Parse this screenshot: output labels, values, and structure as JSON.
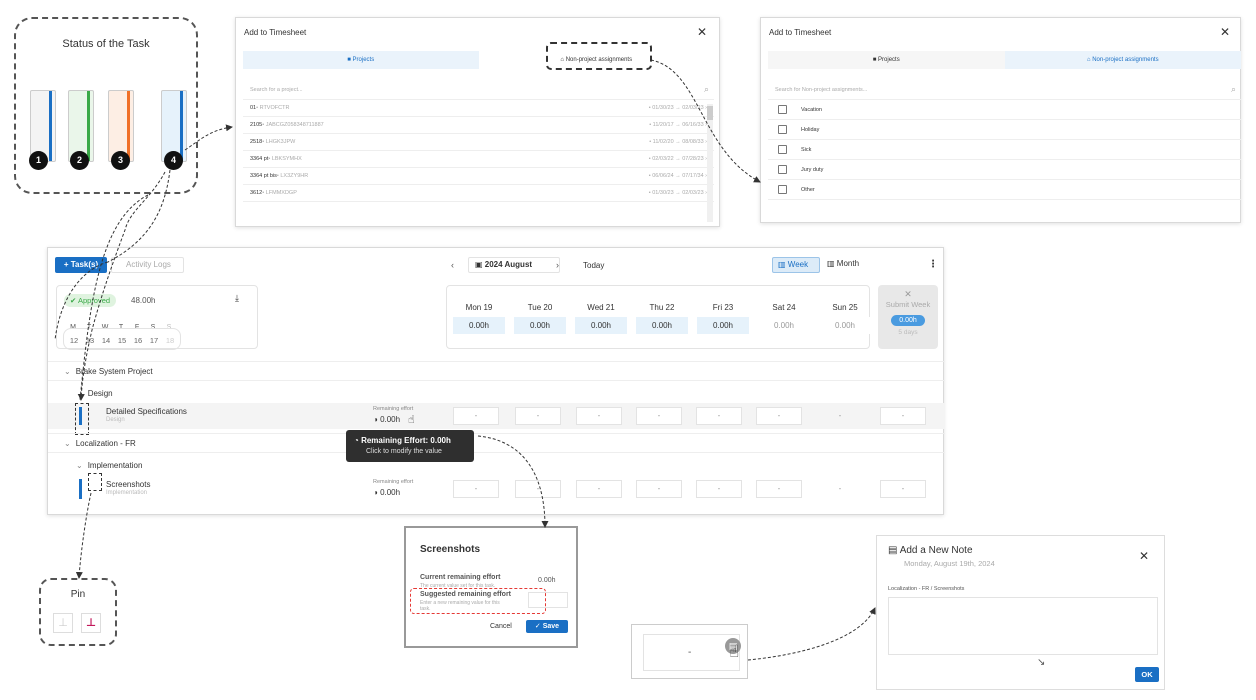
{
  "status_box": {
    "title": "Status of the Task",
    "numbers": [
      "1",
      "2",
      "3",
      "4"
    ],
    "bar_colors": [
      "#1a6fc4",
      "#3aa948",
      "#f07028",
      "#1a6fc4"
    ],
    "bar_bg": [
      "#f4f4f4",
      "#eaf6ea",
      "#fdeee4",
      "#e6f2fb"
    ]
  },
  "pin_box": {
    "title": "Pin"
  },
  "timesheet_projects": {
    "title": "Add to Timesheet",
    "tab_projects": "Projects",
    "tab_nonproject": "Non-project assignments",
    "search_placeholder": "Search for a project...",
    "rows": [
      {
        "name": "01",
        "code": " • RTVOFCTR",
        "dates": "• 01/30/23 → 02/03/23  ›"
      },
      {
        "name": "2105",
        "code": " • JABCGZ0583487118​87",
        "dates": "• 11/20/17 → 06/16/33  ›"
      },
      {
        "name": "2518",
        "code": " • LHGK3JPW",
        "dates": "• 11/02/20 → 08/08/33  ›"
      },
      {
        "name": "3364 pt",
        "code": " • LBKSYMHX",
        "dates": "• 02/03/22 → 07/28/23  ›"
      },
      {
        "name": "3364 pt bis",
        "code": " • LX3ZY9HR",
        "dates": "• 06/06/24 → 07/17/34  ›"
      },
      {
        "name": "3612",
        "code": " • LFMMXDGP",
        "dates": "• 01/30/23 → 02/03/23  ›"
      }
    ]
  },
  "timesheet_nonproject": {
    "title": "Add to Timesheet",
    "tab_projects": "Projects",
    "tab_nonproject": "Non-project assignments",
    "search_placeholder": "Search for Non-project assignments...",
    "items": [
      "Vacation",
      "Holiday",
      "Sick",
      "Jury duty",
      "Other"
    ]
  },
  "main": {
    "add_task": "+ Task(s)",
    "activity_logs": "Activity Logs",
    "month_label": "2024 August",
    "today": "Today",
    "week": "Week",
    "month": "Month",
    "approved": "Approved",
    "hours": "48.00h",
    "weekday_letters": [
      "M",
      "T",
      "W",
      "T",
      "F",
      "S",
      "S"
    ],
    "weekday_numbers": [
      "12",
      "13",
      "14",
      "15",
      "16",
      "17",
      "18"
    ],
    "days": [
      {
        "name": "Mon 19",
        "value": "0.00h"
      },
      {
        "name": "Tue 20",
        "value": "0.00h"
      },
      {
        "name": "Wed 21",
        "value": "0.00h"
      },
      {
        "name": "Thu 22",
        "value": "0.00h"
      },
      {
        "name": "Fri 23",
        "value": "0.00h"
      },
      {
        "name": "Sat 24",
        "value": "0.00h"
      },
      {
        "name": "Sun 25",
        "value": "0.00h"
      }
    ],
    "submit_week": "Submit Week",
    "submit_value": "0.00h",
    "submit_days": "5 days",
    "project1": "Brake System Project",
    "phase1": "Design",
    "task1": "Detailed Specifications",
    "task1_sub": "Design",
    "remaining_label": "Remaining effort",
    "remaining_value": "0.00h",
    "project2": "Localization - FR",
    "phase2": "Implementation",
    "task2": "Screenshots",
    "task2_sub": "Implementation",
    "dash": "-",
    "tooltip_title": "Remaining Effort: 0.00h",
    "tooltip_sub": "Click to modify the value"
  },
  "screenshots_popup": {
    "title": "Screenshots",
    "current_label": "Current remaining effort",
    "current_sub": "The current value set for this task.",
    "current_value": "0.00h",
    "suggested_label": "Suggested remaining effort",
    "suggested_sub": "Enter a new remaining value for this task.",
    "cancel": "Cancel",
    "save": "Save"
  },
  "cell_zoom": {
    "dash": "-"
  },
  "note_dialog": {
    "title": "Add a New Note",
    "date": "Monday, August 19th, 2024",
    "path": "Localization - FR / Screenshots",
    "ok": "OK"
  }
}
